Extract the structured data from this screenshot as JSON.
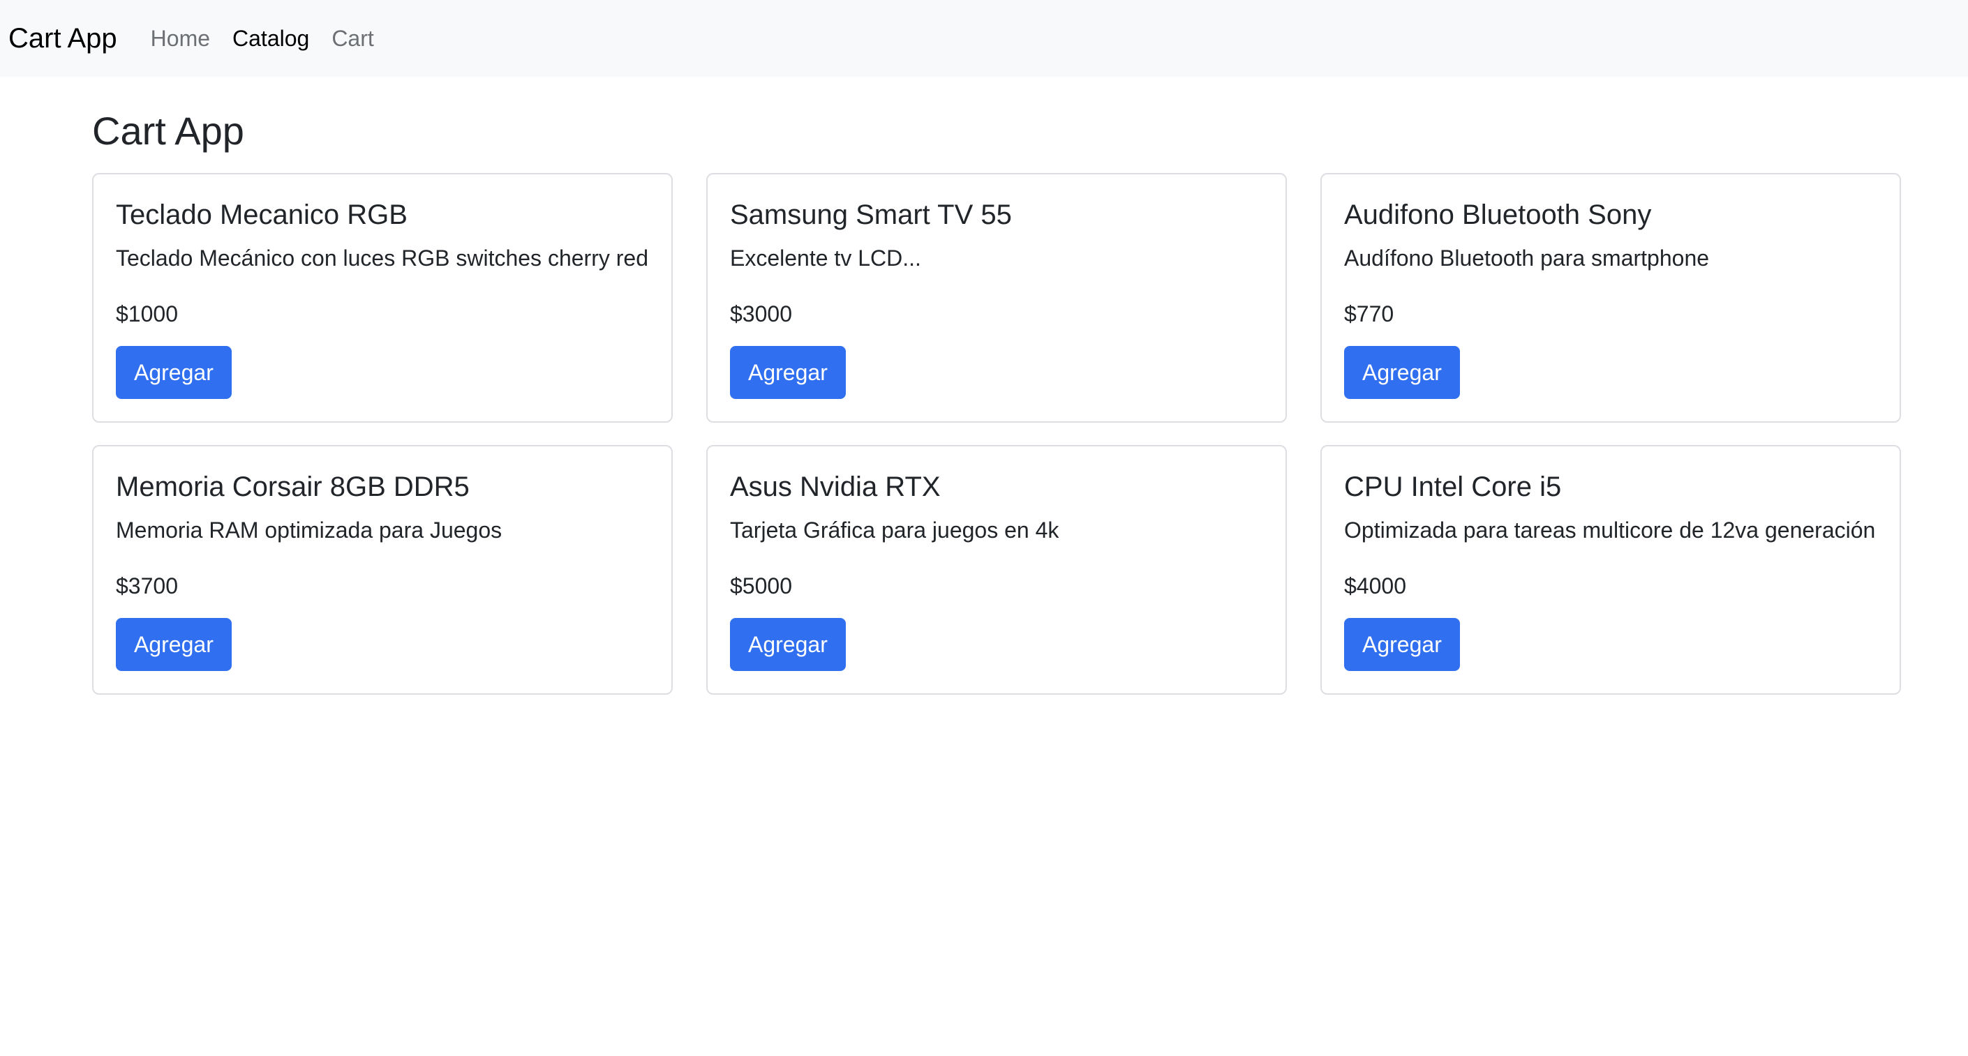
{
  "navbar": {
    "brand": "Cart App",
    "links": [
      {
        "label": "Home",
        "active": false
      },
      {
        "label": "Catalog",
        "active": true
      },
      {
        "label": "Cart",
        "active": false
      }
    ]
  },
  "page": {
    "title": "Cart App"
  },
  "products": [
    {
      "title": "Teclado Mecanico RGB",
      "description": "Teclado Mecánico con luces RGB switches cherry red",
      "price": "$1000",
      "button_label": "Agregar"
    },
    {
      "title": "Samsung Smart TV 55",
      "description": "Excelente tv LCD...",
      "price": "$3000",
      "button_label": "Agregar"
    },
    {
      "title": "Audifono Bluetooth Sony",
      "description": "Audífono Bluetooth para smartphone",
      "price": "$770",
      "button_label": "Agregar"
    },
    {
      "title": "Memoria Corsair 8GB DDR5",
      "description": "Memoria RAM optimizada para Juegos",
      "price": "$3700",
      "button_label": "Agregar"
    },
    {
      "title": "Asus Nvidia RTX",
      "description": "Tarjeta Gráfica para juegos en 4k",
      "price": "$5000",
      "button_label": "Agregar"
    },
    {
      "title": "CPU Intel Core i5",
      "description": "Optimizada para tareas multicore de 12va generación",
      "price": "$4000",
      "button_label": "Agregar"
    }
  ],
  "colors": {
    "navbar_bg": "#f8f9fa",
    "button_primary": "#2f6ff0",
    "card_border": "#dcdee1"
  }
}
